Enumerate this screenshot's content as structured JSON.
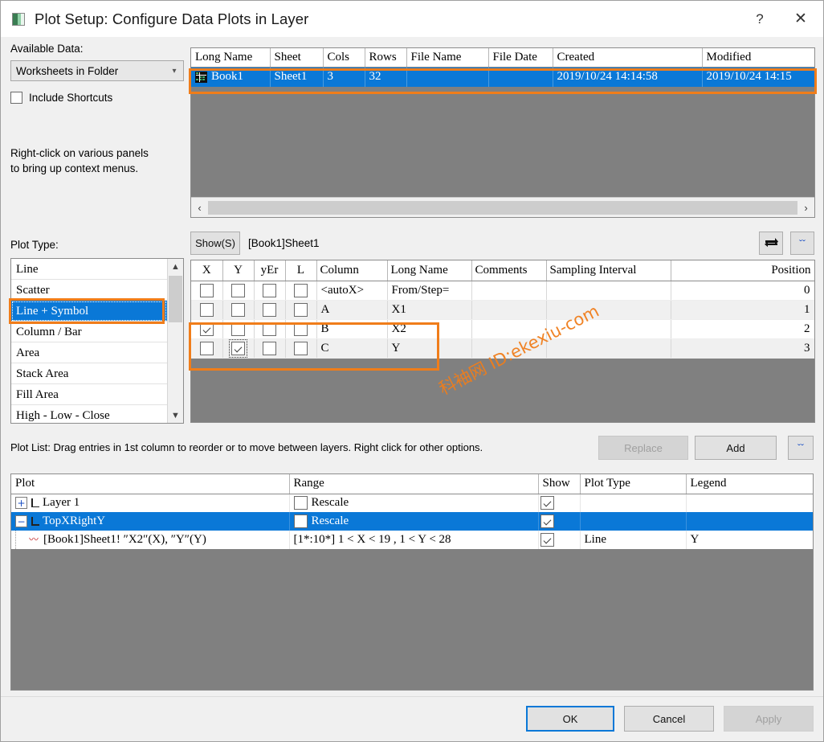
{
  "window": {
    "title": "Plot Setup: Configure Data Plots in Layer",
    "help_label": "?",
    "close_label": "✕"
  },
  "left_panel": {
    "available_data_label": "Available Data:",
    "source_select_value": "Worksheets in Folder",
    "include_shortcuts_label": "Include Shortcuts",
    "include_shortcuts_checked": false,
    "hint_line1": "Right-click on various panels",
    "hint_line2": "to bring up context menus.",
    "plot_type_label": "Plot Type:",
    "plot_types": [
      {
        "label": "Line",
        "selected": false
      },
      {
        "label": "Scatter",
        "selected": false
      },
      {
        "label": "Line + Symbol",
        "selected": true
      },
      {
        "label": "Column / Bar",
        "selected": false
      },
      {
        "label": "Area",
        "selected": false
      },
      {
        "label": "Stack Area",
        "selected": false
      },
      {
        "label": "Fill Area",
        "selected": false
      },
      {
        "label": "High - Low - Close",
        "selected": false
      }
    ]
  },
  "worksheet_table": {
    "headers": [
      "Long Name",
      "Sheet",
      "Cols",
      "Rows",
      "File Name",
      "File Date",
      "Created",
      "Modified"
    ],
    "rows": [
      {
        "selected": true,
        "long_name": "Book1",
        "sheet": "Sheet1",
        "cols": "3",
        "rows": "32",
        "file_name": "",
        "file_date": "",
        "created": "2019/10/24 14:14:58",
        "modified": "2019/10/24 14:15"
      }
    ],
    "scroll_left_icon": "‹",
    "scroll_right_icon": "›"
  },
  "show_bar": {
    "show_button": "Show(S)",
    "path": "[Book1]Sheet1",
    "swap_icon": "⇄",
    "expand_icon": "ˇˇ"
  },
  "columns_table": {
    "headers": [
      "X",
      "Y",
      "yEr",
      "L",
      "Column",
      "Long Name",
      "Comments",
      "Sampling Interval",
      "Position"
    ],
    "rows": [
      {
        "x": false,
        "y": false,
        "yer": false,
        "l": false,
        "column": "<autoX>",
        "long_name": "From/Step=",
        "comments": "",
        "sampling_interval": "",
        "position": "0",
        "alt": false
      },
      {
        "x": false,
        "y": false,
        "yer": false,
        "l": false,
        "column": "A",
        "long_name": "X1",
        "comments": "",
        "sampling_interval": "",
        "position": "1",
        "alt": true
      },
      {
        "x": true,
        "y": false,
        "yer": false,
        "l": false,
        "column": "B",
        "long_name": "X2",
        "comments": "",
        "sampling_interval": "",
        "position": "2",
        "alt": false
      },
      {
        "x": false,
        "y": true,
        "yer": false,
        "l": false,
        "column": "C",
        "long_name": "Y",
        "comments": "",
        "sampling_interval": "",
        "position": "3",
        "alt": true
      }
    ]
  },
  "plot_list": {
    "hint": "Plot List: Drag entries in 1st column to reorder or to move between layers. Right click for other options.",
    "replace_label": "Replace",
    "add_label": "Add",
    "expand_icon": "ˇˇ",
    "headers": [
      "Plot",
      "Range",
      "Show",
      "Plot Type",
      "Legend"
    ],
    "rows": [
      {
        "type": "layer",
        "expander": "+",
        "plot": "Layer 1",
        "range": "Rescale",
        "range_checked": false,
        "show_checked": true,
        "plot_type": "",
        "legend": "",
        "selected": false
      },
      {
        "type": "layer",
        "expander": "−",
        "plot": "TopXRightY",
        "range": "Rescale",
        "range_checked": false,
        "show_checked": true,
        "plot_type": "",
        "legend": "",
        "selected": true
      },
      {
        "type": "plot",
        "expander": "",
        "plot": "[Book1]Sheet1! ″X2″(X), ″Y″(Y)",
        "range": "[1*:10*]   1 < X < 19 ,  1 < Y < 28",
        "range_checked": null,
        "show_checked": true,
        "plot_type": "Line",
        "legend": "Y",
        "selected": false
      }
    ]
  },
  "footer": {
    "ok_label": "OK",
    "cancel_label": "Cancel",
    "apply_label": "Apply"
  },
  "watermark": {
    "text": "科袖网  ID:ekexiu-com",
    "color": "#f07d1a"
  },
  "highlight_color": "#f07d1a",
  "accent_color": "#0a78d7"
}
